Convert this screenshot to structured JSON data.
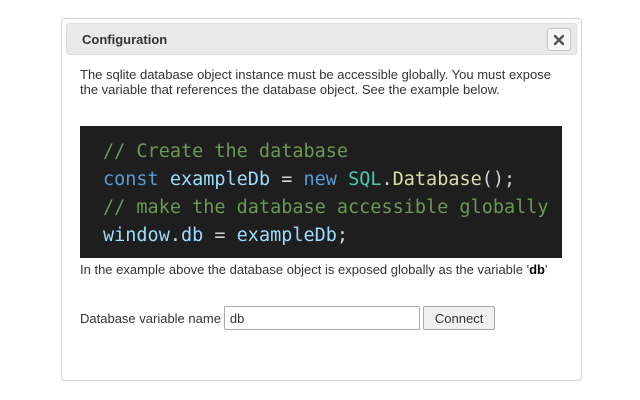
{
  "dialog": {
    "title": "Configuration",
    "close_icon": "close-icon",
    "description": "The sqlite database object instance must be accessible globally. You must expose the variable that references the database object. See the example below.",
    "code": {
      "line1_comment": "// Create the database",
      "line2_kw_const": "const",
      "line2_var": "exampleDb",
      "line2_eq": "=",
      "line2_kw_new": "new",
      "line2_type": "SQL",
      "line2_dot": ".",
      "line2_fn": "Database",
      "line2_tail": "();",
      "line3_comment": "// make the database accessible globally",
      "line4_window": "window",
      "line4_dot": ".",
      "line4_db": "db",
      "line4_eq": "=",
      "line4_var": "exampleDb",
      "line4_semi": ";"
    },
    "note_prefix": "In the example above the database object is exposed globally as the variable '",
    "note_var": "db",
    "note_suffix": "'",
    "form": {
      "label": "Database variable name",
      "input_value": "db",
      "connect_label": "Connect"
    },
    "colors": {
      "code_bg": "#1e1e1e",
      "comment": "#6a9955",
      "keyword": "#569cd6",
      "variable": "#9cdcfe",
      "type": "#4ec9b0",
      "function": "#dcdcaa"
    }
  }
}
